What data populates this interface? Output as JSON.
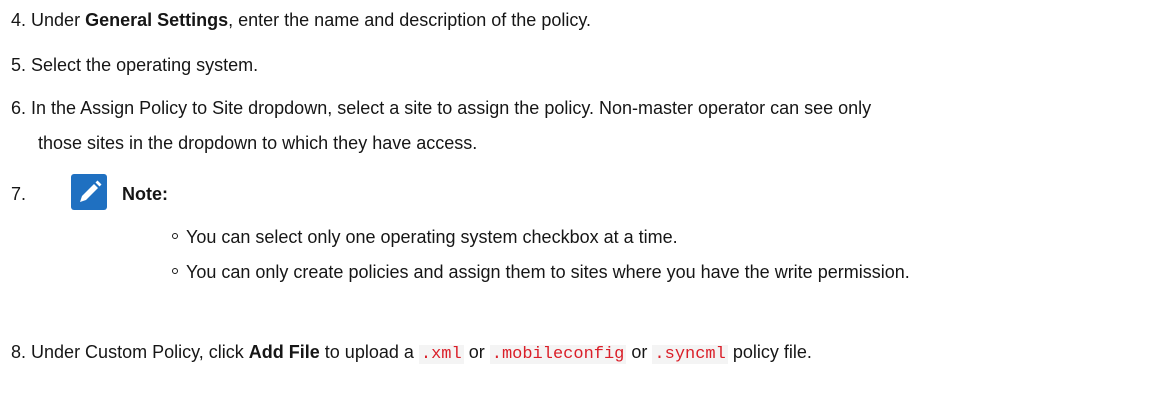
{
  "steps": {
    "s4": {
      "num": "4.",
      "pre": "Under",
      "bold": "General Settings",
      "post": ", enter the name and description of the policy."
    },
    "s5": {
      "num": "5.",
      "text": "Select the operating system."
    },
    "s6": {
      "num": "6.",
      "line1": "In the Assign Policy to Site dropdown, select a site to assign the policy. Non-master operator can see only",
      "line2": "those sites in the dropdown to which they have access."
    },
    "s7": {
      "num": "7.",
      "note_label": "Note:",
      "bullets": [
        "You can select only one operating system checkbox at a time.",
        "You can only create policies and assign them to sites where you have the write permission."
      ]
    },
    "s8": {
      "num": "8.",
      "pre": "Under Custom Policy, click",
      "bold": "Add File",
      "mid1": "to upload a",
      "code1": ".xml",
      "mid2": "or",
      "code2": ".mobileconfig",
      "mid3": "or",
      "code3": ".syncml",
      "post": "policy file."
    }
  },
  "icons": {
    "note": "pencil-note-icon"
  },
  "colors": {
    "note_icon_bg": "#1f70c1",
    "code_text": "#da1e28"
  }
}
